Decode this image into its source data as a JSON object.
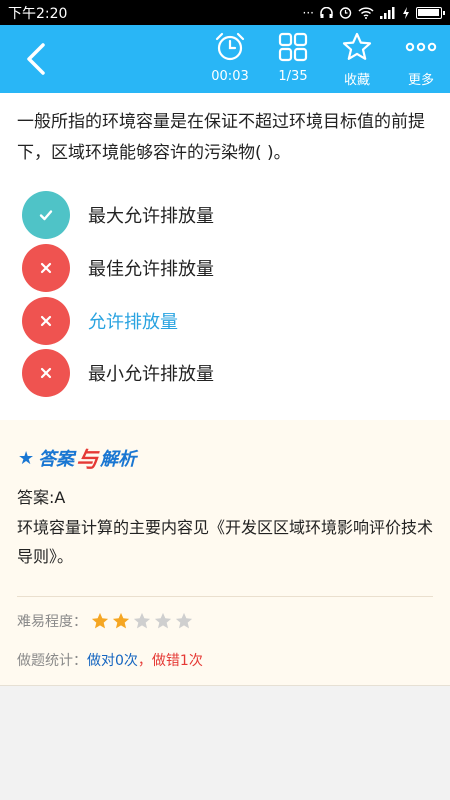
{
  "status_bar": {
    "time": "下午2:20",
    "icons": [
      "more-dots-icon",
      "headphones-icon",
      "alarm-icon",
      "wifi-icon",
      "signal-icon",
      "charging-icon",
      "battery-icon"
    ]
  },
  "toolbar": {
    "timer_label": "00:03",
    "progress_label": "1/35",
    "favorite_label": "收藏",
    "more_label": "更多"
  },
  "question": {
    "text": "一般所指的环境容量是在保证不超过环境目标值的前提下，区域环境能够容许的污染物(   )。",
    "options": [
      {
        "text": "最大允许排放量",
        "state": "correct",
        "color": "#222222"
      },
      {
        "text": "最佳允许排放量",
        "state": "wrong",
        "color": "#222222"
      },
      {
        "text": "允许排放量",
        "state": "wrong",
        "color": "#29a3e0"
      },
      {
        "text": "最小允许排放量",
        "state": "wrong",
        "color": "#222222"
      }
    ]
  },
  "analysis": {
    "title_star": "★",
    "title_part1": "答案",
    "title_part2": "与",
    "title_part3": "解析",
    "answer": "答案:A",
    "explanation": "环境容量计算的主要内容见《开发区区域环境影响评价技术导则》。",
    "difficulty_label": "难易程度：",
    "difficulty_rating": 2,
    "difficulty_max": 5,
    "stats_label": "做题统计：",
    "stats_correct": "做对0次",
    "stats_sep": "，",
    "stats_wrong": "做错1次"
  },
  "colors": {
    "accent": "#29b6f6",
    "correct": "#4fc3c7",
    "wrong": "#ef5350",
    "star_on": "#f5a623",
    "star_off": "#cfcfcf"
  }
}
